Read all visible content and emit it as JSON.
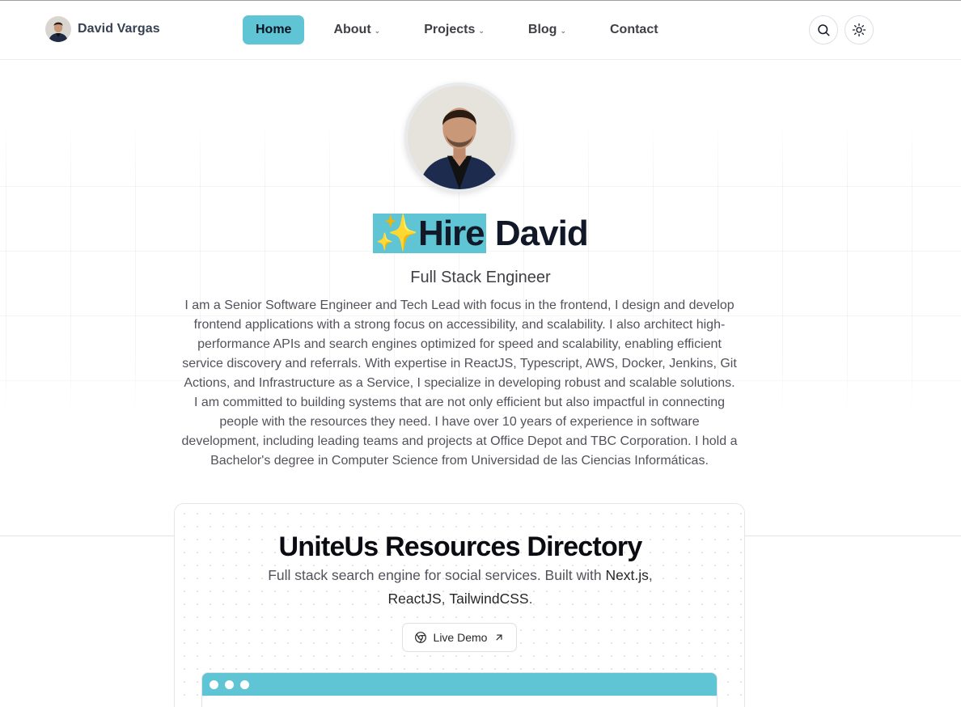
{
  "brand": {
    "name": "David Vargas"
  },
  "nav": {
    "items": [
      {
        "label": "Home"
      },
      {
        "label": "About"
      },
      {
        "label": "Projects"
      },
      {
        "label": "Blog"
      },
      {
        "label": "Contact"
      }
    ]
  },
  "hero": {
    "title_highlight": "✨Hire",
    "title_rest": "David",
    "subtitle": "Full Stack Engineer",
    "bio": "I am a Senior Software Engineer and Tech Lead with focus in the frontend, I design and develop frontend applications with a strong focus on accessibility, and scalability. I also architect high-performance APIs and search engines optimized for speed and scalability, enabling efficient service discovery and referrals. With expertise in ReactJS, Typescript, AWS, Docker, Jenkins, Git Actions, and Infrastructure as a Service, I specialize in developing robust and scalable solutions. I am committed to building systems that are not only efficient but also impactful in connecting people with the resources they need. I have over 10 years of experience in software development, including leading teams and projects at Office Depot and TBC Corporation. I hold a Bachelor's degree in Computer Science from Universidad de las Ciencias Informáticas."
  },
  "project": {
    "title": "UniteUs Resources Directory",
    "desc_prefix": "Full stack search engine for social services. Built with ",
    "tech1": "Next.js",
    "sep1": ", ",
    "tech2": "ReactJS",
    "sep2": ", ",
    "tech3": "TailwindCSS",
    "desc_suffix": ".",
    "demo_label": "Live Demo"
  },
  "colors": {
    "accent": "#5fc4d4"
  }
}
